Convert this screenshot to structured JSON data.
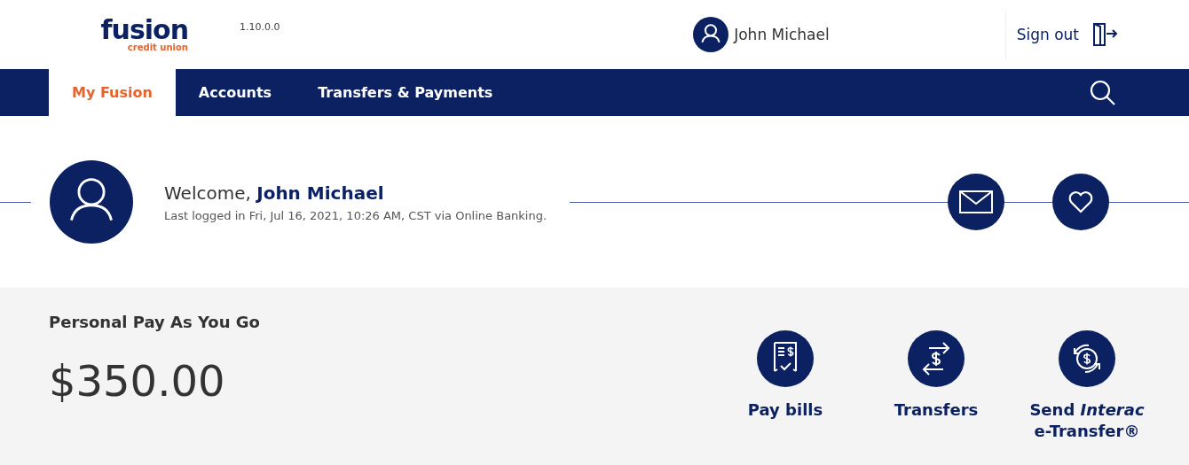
{
  "header": {
    "logo": {
      "name": "fusion",
      "tagline": "credit union"
    },
    "version": "1.10.0.0",
    "user": "John Michael",
    "sign_out": "Sign out"
  },
  "nav": {
    "tabs": [
      {
        "label": "My Fusion",
        "selected": true
      },
      {
        "label": "Accounts",
        "selected": false
      },
      {
        "label": "Transfers & Payments",
        "selected": false
      }
    ]
  },
  "welcome": {
    "greeting": "Welcome, **John Michael**",
    "last_login": "Last logged in Fri, Jul 16, 2021, 10:26 AM, CST via Online Banking."
  },
  "account": {
    "name": "Personal Pay As You Go",
    "balance": "$350.00"
  },
  "quick_actions": [
    {
      "kind": "bills",
      "label": "Pay bills"
    },
    {
      "kind": "transfer",
      "label": "Transfers"
    },
    {
      "kind": "etransfer",
      "label": "Send *Interac* e-Transfer®"
    }
  ]
}
